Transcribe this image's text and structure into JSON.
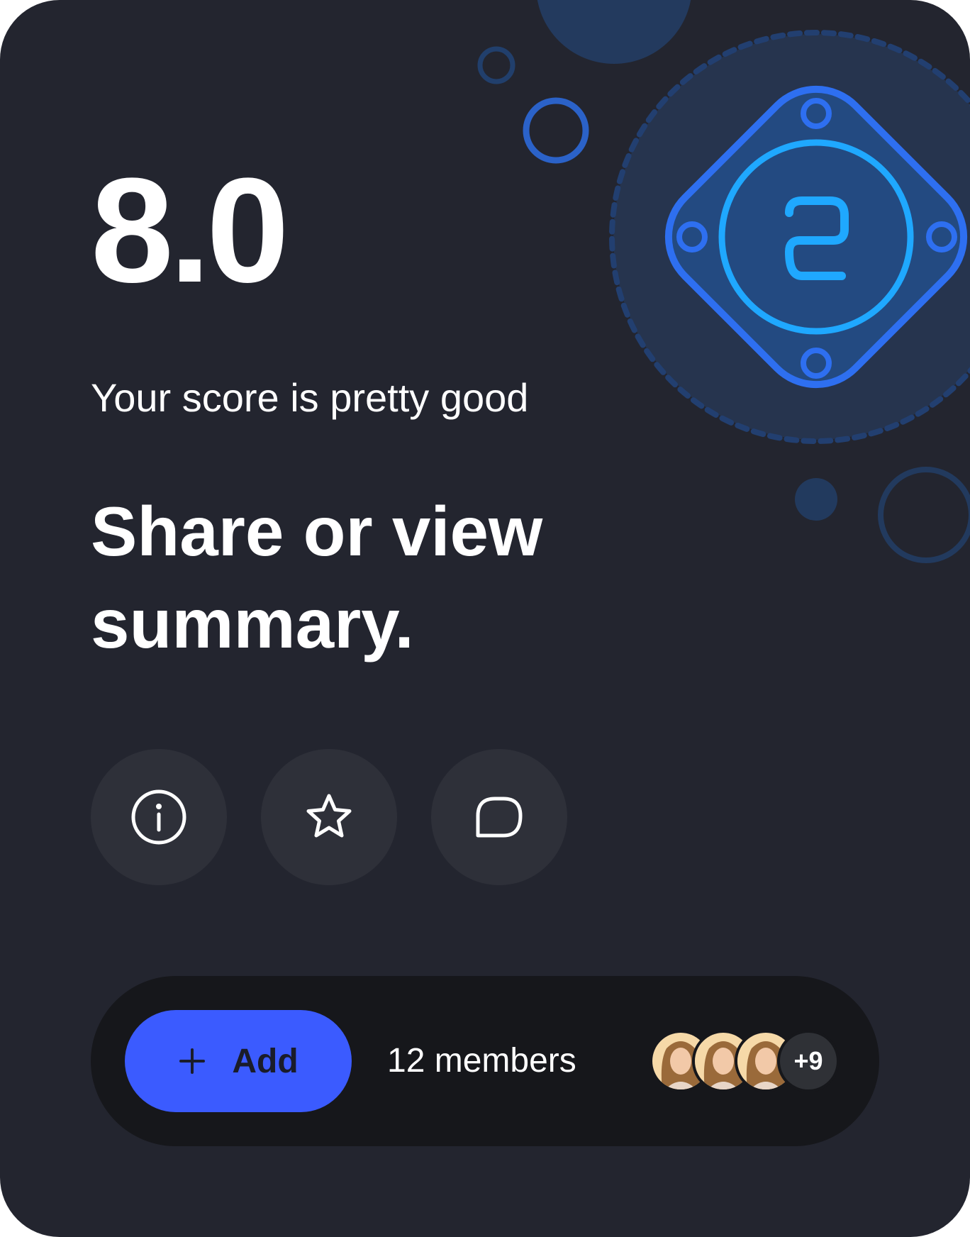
{
  "score": {
    "value": "8.0",
    "caption": "Your score is pretty good"
  },
  "headline": "Share or view summary.",
  "badge": {
    "icon": "badge-2-icon"
  },
  "actions": [
    {
      "icon": "info-icon"
    },
    {
      "icon": "star-icon"
    },
    {
      "icon": "chat-bubble-icon"
    }
  ],
  "bar": {
    "add_label": "Add",
    "add_icon": "plus-icon",
    "members_text": "12 members",
    "more_count": "+9"
  },
  "colors": {
    "card_bg": "#23252f",
    "accent": "#3b5bff",
    "badge_blue": "#2e6ff0",
    "badge_cyan": "#1fa8ff"
  }
}
